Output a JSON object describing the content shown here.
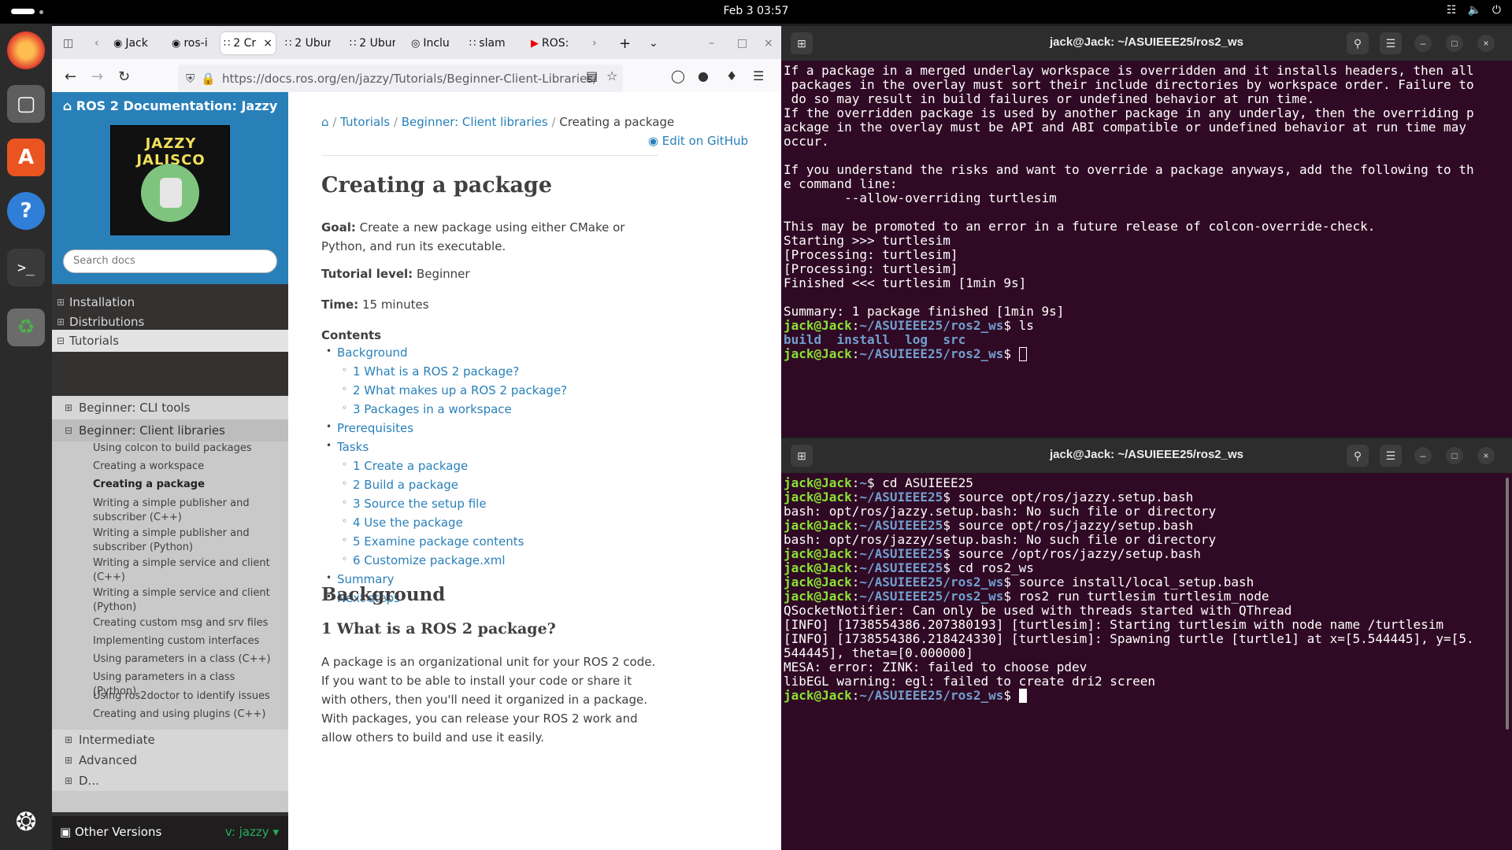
{
  "topbar": {
    "clock": "Feb 3  03:57",
    "tray": [
      "network-icon",
      "volume-icon",
      "power-icon"
    ]
  },
  "dock": {
    "apps": [
      "firefox-icon",
      "files-icon",
      "app-center-icon",
      "help-icon",
      "terminal-icon",
      "trash-icon",
      "show-apps-icon"
    ]
  },
  "browser": {
    "tabs": [
      {
        "label": "Jack"
      },
      {
        "label": "ros-i"
      },
      {
        "label": "2 Cr"
      },
      {
        "label": "2 Ubur"
      },
      {
        "label": "2 Ubur"
      },
      {
        "label": "Inclu"
      },
      {
        "label": "slam"
      },
      {
        "label": "ROS:"
      }
    ],
    "url": "https://docs.ros.org/en/jazzy/Tutorials/Beginner-Client-Libraries/",
    "docs": {
      "site_title": "ROS 2 Documentation: Jazzy",
      "logo_text": "JAZZY JALISCO",
      "search_placeholder": "Search docs",
      "nav_top": [
        "Installation",
        "Distributions",
        "Tutorials"
      ],
      "nav_sub": [
        "Beginner: CLI tools",
        "Beginner: Client libraries",
        "Intermediate",
        "Advanced",
        "D..."
      ],
      "nav_third": [
        "Using colcon to build packages",
        "Creating a workspace",
        "Creating a package",
        "Writing a simple publisher and subscriber (C++)",
        "Writing a simple publisher and subscriber (Python)",
        "Writing a simple service and client (C++)",
        "Writing a simple service and client (Python)",
        "Creating custom msg and srv files",
        "Implementing custom interfaces",
        "Using parameters in a class (C++)",
        "Using parameters in a class (Python)",
        "Using ros2doctor to identify issues",
        "Creating and using plugins (C++)"
      ],
      "footer_left": "Other Versions",
      "footer_right": "v: jazzy",
      "breadcrumb": [
        "Tutorials",
        "Beginner: Client libraries",
        "Creating a package"
      ],
      "edit_github": "Edit on GitHub",
      "h1": "Creating a package",
      "goal_label": "Goal:",
      "goal": "Create a new package using either CMake or Python, and run its executable.",
      "level_label": "Tutorial level:",
      "level": "Beginner",
      "time_label": "Time:",
      "time": "15 minutes",
      "contents_label": "Contents",
      "toc": [
        "Background",
        "1 What is a ROS 2 package?",
        "2 What makes up a ROS 2 package?",
        "3 Packages in a workspace",
        "Prerequisites",
        "Tasks",
        "1 Create a package",
        "2 Build a package",
        "3 Source the setup file",
        "4 Use the package",
        "5 Examine package contents",
        "6 Customize package.xml",
        "Summary",
        "Next steps"
      ],
      "h2": "Background",
      "h3": "1 What is a ROS 2 package?",
      "body": "A package is an organizational unit for your ROS 2 code. If you want to be able to install your code or share it with others, then you'll need it organized in a package. With packages, you can release your ROS 2 work and allow others to build and use it easily."
    }
  },
  "terminal_top": {
    "title": "jack@Jack: ~/ASUIEEE25/ros2_ws",
    "lines": [
      "If a package in a merged underlay workspace is overridden and it installs headers, then all",
      " packages in the overlay must sort their include directories by workspace order. Failure to",
      " do so may result in build failures or undefined behavior at run time.",
      "If the overridden package is used by another package in any underlay, then the overriding p",
      "ackage in the overlay must be API and ABI compatible or undefined behavior at run time may",
      "occur.",
      "",
      "If you understand the risks and want to override a package anyways, add the following to th",
      "e command line:",
      "        --allow-overriding turtlesim",
      "",
      "This may be promoted to an error in a future release of colcon-override-check.",
      "Starting >>> turtlesim",
      "[Processing: turtlesim]",
      "[Processing: turtlesim]",
      "Finished <<< turtlesim [1min 9s]",
      "",
      "Summary: 1 package finished [1min 9s]"
    ],
    "prompt_user": "jack@Jack",
    "prompt_path": "~/ASUIEEE25/ros2_ws",
    "ls_cmd": " ls",
    "ls_out": [
      "build",
      "install",
      "log",
      "src"
    ]
  },
  "terminal_bottom": {
    "title": "jack@Jack: ~/ASUIEEE25/ros2_ws",
    "lines": [
      {
        "p": "~",
        "c": " cd ASUIEEE25"
      },
      {
        "p": "~/ASUIEEE25",
        "c": " source opt/ros/jazzy.setup.bash"
      },
      {
        "o": "bash: opt/ros/jazzy.setup.bash: No such file or directory"
      },
      {
        "p": "~/ASUIEEE25",
        "c": " source opt/ros/jazzy/setup.bash"
      },
      {
        "o": "bash: opt/ros/jazzy/setup.bash: No such file or directory"
      },
      {
        "p": "~/ASUIEEE25",
        "c": " source /opt/ros/jazzy/setup.bash"
      },
      {
        "p": "~/ASUIEEE25",
        "c": " cd ros2_ws"
      },
      {
        "p": "~/ASUIEEE25/ros2_ws",
        "c": " source install/local_setup.bash"
      },
      {
        "p": "~/ASUIEEE25/ros2_ws",
        "c": " ros2 run turtlesim turtlesim_node"
      },
      {
        "o": "QSocketNotifier: Can only be used with threads started with QThread"
      },
      {
        "o": "[INFO] [1738554386.207380193] [turtlesim]: Starting turtlesim with node name /turtlesim"
      },
      {
        "o": "[INFO] [1738554386.218424330] [turtlesim]: Spawning turtle [turtle1] at x=[5.544445], y=[5."
      },
      {
        "o": "544445], theta=[0.000000]"
      },
      {
        "o": "MESA: error: ZINK: failed to choose pdev"
      },
      {
        "o": "libEGL warning: egl: failed to create dri2 screen"
      },
      {
        "p": "~/ASUIEEE25/ros2_ws",
        "c": " "
      }
    ]
  }
}
